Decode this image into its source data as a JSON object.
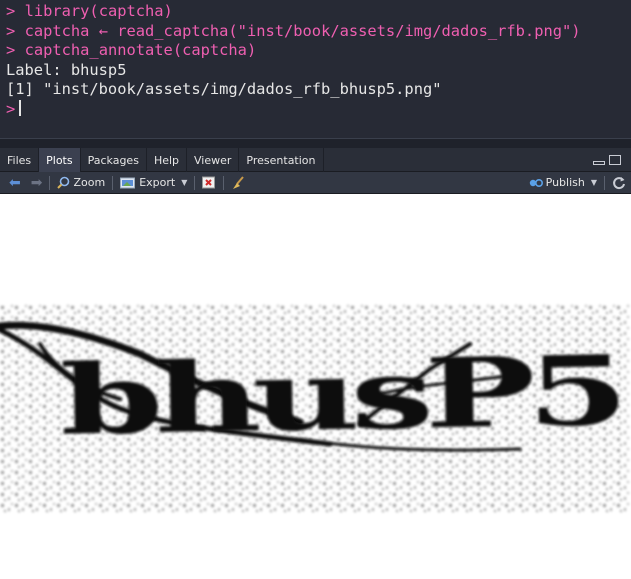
{
  "console": {
    "lines": [
      {
        "prompt": ">",
        "text": "library(captcha)"
      },
      {
        "prompt": ">",
        "text": "captcha ← read_captcha(\"inst/book/assets/img/dados_rfb.png\")"
      },
      {
        "prompt": ">",
        "text": "captcha_annotate(captcha)"
      }
    ],
    "output": [
      "Label: bhusp5",
      "[1] \"inst/book/assets/img/dados_rfb_bhusp5.png\""
    ],
    "current_prompt": ">"
  },
  "pane": {
    "tabs": [
      {
        "label": "Files",
        "active": false
      },
      {
        "label": "Plots",
        "active": true
      },
      {
        "label": "Packages",
        "active": false
      },
      {
        "label": "Help",
        "active": false
      },
      {
        "label": "Viewer",
        "active": false
      },
      {
        "label": "Presentation",
        "active": false
      }
    ]
  },
  "toolbar": {
    "back_icon": "arrow-left-icon",
    "forward_icon": "arrow-right-icon",
    "zoom_label": "Zoom",
    "export_label": "Export",
    "remove_icon": "remove-plot-icon",
    "clear_icon": "broom-icon",
    "publish_label": "Publish",
    "refresh_icon": "refresh-icon"
  },
  "plot": {
    "captcha_text": "bhusP5"
  },
  "colors": {
    "console_bg": "#272a35",
    "prompt": "#ef5fb1",
    "output_text": "#e6e6e6",
    "active_tab": "#3b4050",
    "toolbar_bg": "#323743"
  }
}
